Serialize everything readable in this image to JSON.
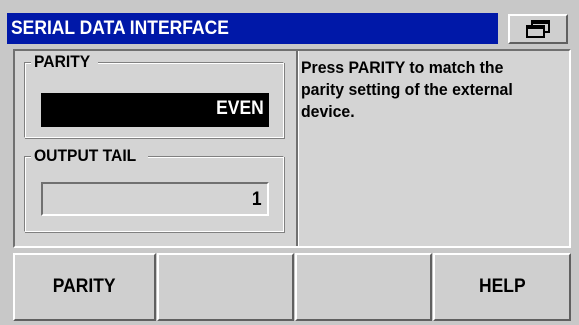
{
  "header": {
    "title": "SERIAL DATA INTERFACE",
    "mode_icon": "window-toggle-icon"
  },
  "form": {
    "parity": {
      "label": "PARITY",
      "value": "EVEN",
      "selected": true
    },
    "output_tail": {
      "label": "OUTPUT TAIL",
      "value": "1",
      "selected": false
    }
  },
  "help_text": "Press PARITY to match the parity setting of the external device.",
  "softkeys": [
    {
      "label": "PARITY"
    },
    {
      "label": ""
    },
    {
      "label": ""
    },
    {
      "label": "HELP"
    }
  ],
  "colors": {
    "title_bg": "#0018a8",
    "panel_bg": "#d4d4d4",
    "active_field_bg": "#000000"
  }
}
